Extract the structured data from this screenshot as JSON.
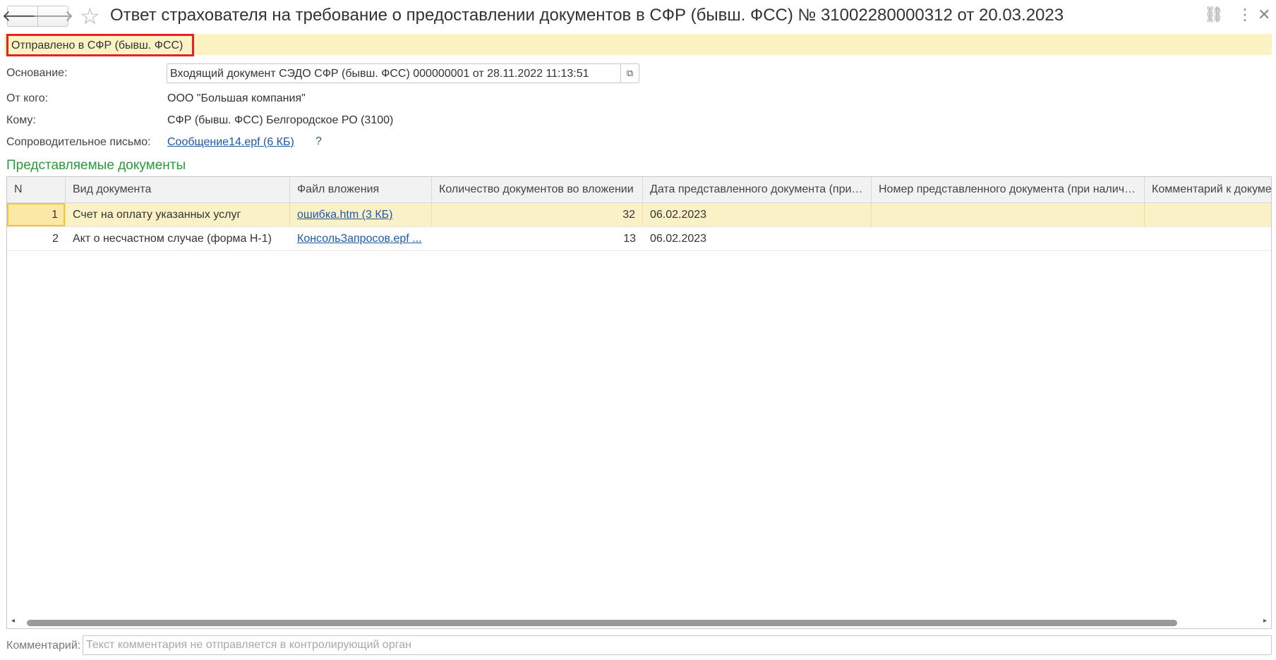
{
  "window": {
    "title": "Ответ страхователя на требование о предоставлении документов в СФР (бывш. ФСС) № 31002280000312 от 20.03.2023",
    "back_icon": "🡐",
    "forward_icon": "🡒",
    "star_icon": "☆",
    "link_icon": "⛓",
    "more_icon": "⋮",
    "close_icon": "✕"
  },
  "status": {
    "text": "Отправлено в СФР (бывш. ФСС)",
    "highlight_color": "#e8201f",
    "bar_color": "#fbf3c3"
  },
  "form": {
    "basis_label": "Основание:",
    "basis_value": "Входящий документ СЭДО СФР (бывш. ФСС) 000000001 от 28.11.2022 11:13:51",
    "open_icon": "⧉",
    "from_label": "От кого:",
    "from_value": "ООО \"Большая компания\"",
    "to_label": "Кому:",
    "to_value": "СФР (бывш. ФСС) Белгородское РО (3100)",
    "letter_label": "Сопроводительное письмо:",
    "letter_value": "Сообщение14.epf (6 КБ)",
    "help_text": "?"
  },
  "documents": {
    "title": "Представляемые документы",
    "columns": [
      "N",
      "Вид документа",
      "Файл вложения",
      "Количество документов во вложении",
      "Дата представленного документа (при ...",
      "Номер представленного документа (при наличии)",
      "Комментарий к докумен"
    ],
    "rows": [
      {
        "n": "1",
        "kind": "Счет на оплату указанных услуг",
        "file": "ошибка.htm (3 КБ)",
        "count": "32",
        "date": "06.02.2023",
        "number": "",
        "comment": ""
      },
      {
        "n": "2",
        "kind": "Акт о несчастном случае (форма Н-1)",
        "file": "КонсольЗапросов.epf ...",
        "count": "13",
        "date": "06.02.2023",
        "number": "",
        "comment": ""
      }
    ]
  },
  "comment": {
    "label": "Комментарий:",
    "placeholder": "Текст комментария не отправляется в контролирующий орган"
  }
}
